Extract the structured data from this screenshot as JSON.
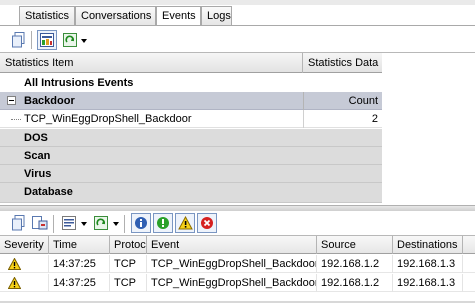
{
  "tabs": [
    {
      "label": "Statistics"
    },
    {
      "label": "Conversations"
    },
    {
      "label": "Events",
      "active": true
    },
    {
      "label": "Logs"
    }
  ],
  "stats": {
    "header_item": "Statistics Item",
    "header_data": "Statistics Data",
    "rows": {
      "all": "All Intrusions Events",
      "backdoor": "Backdoor",
      "backdoor_count_label": "Count",
      "child_name": "TCP_WinEggDropShell_Backdoor",
      "child_value": "2",
      "dos": "DOS",
      "scan": "Scan",
      "virus": "Virus",
      "database": "Database"
    }
  },
  "events": {
    "columns": [
      "Severity",
      "Time",
      "Protocol",
      "Event",
      "Source",
      "Destinations"
    ],
    "rows": [
      {
        "time": "14:37:25",
        "protocol": "TCP",
        "event": "TCP_WinEggDropShell_Backdoor",
        "source": "192.168.1.2",
        "dest": "192.168.1.3"
      },
      {
        "time": "14:37:25",
        "protocol": "TCP",
        "event": "TCP_WinEggDropShell_Backdoor",
        "source": "192.168.1.2",
        "dest": "192.168.1.3"
      }
    ]
  },
  "colors": {
    "warning_fill": "#f7d117",
    "info_blue": "#2f5fb3",
    "green_ok": "#2aa12a",
    "red_stop": "#d62020"
  },
  "icons": [
    "copy-icon",
    "statistics-view-icon",
    "refresh-icon",
    "export-icon",
    "filter-icon",
    "info-icon",
    "green-status-icon",
    "warning-icon",
    "error-icon"
  ]
}
